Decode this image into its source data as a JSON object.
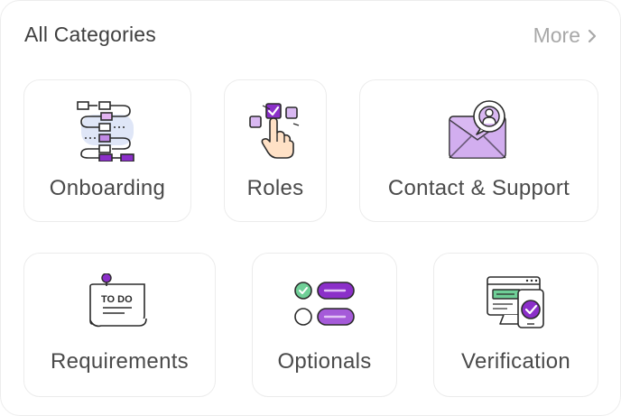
{
  "header": {
    "title": "All Categories",
    "more_label": "More"
  },
  "categories": [
    {
      "label": "Onboarding",
      "icon": "onboarding-flowchart-icon"
    },
    {
      "label": "Roles",
      "icon": "roles-select-hand-icon"
    },
    {
      "label": "Contact & Support",
      "icon": "contact-support-envelope-icon"
    },
    {
      "label": "Requirements",
      "icon": "requirements-todo-note-icon"
    },
    {
      "label": "Optionals",
      "icon": "optionals-toggle-list-icon"
    },
    {
      "label": "Verification",
      "icon": "verification-screen-check-icon"
    }
  ],
  "colors": {
    "accent": "#8b2fc9",
    "accent_light": "#d9b8f2",
    "check_green": "#6fcf97",
    "text": "#4a4a4a",
    "muted": "#a8a8a8"
  }
}
